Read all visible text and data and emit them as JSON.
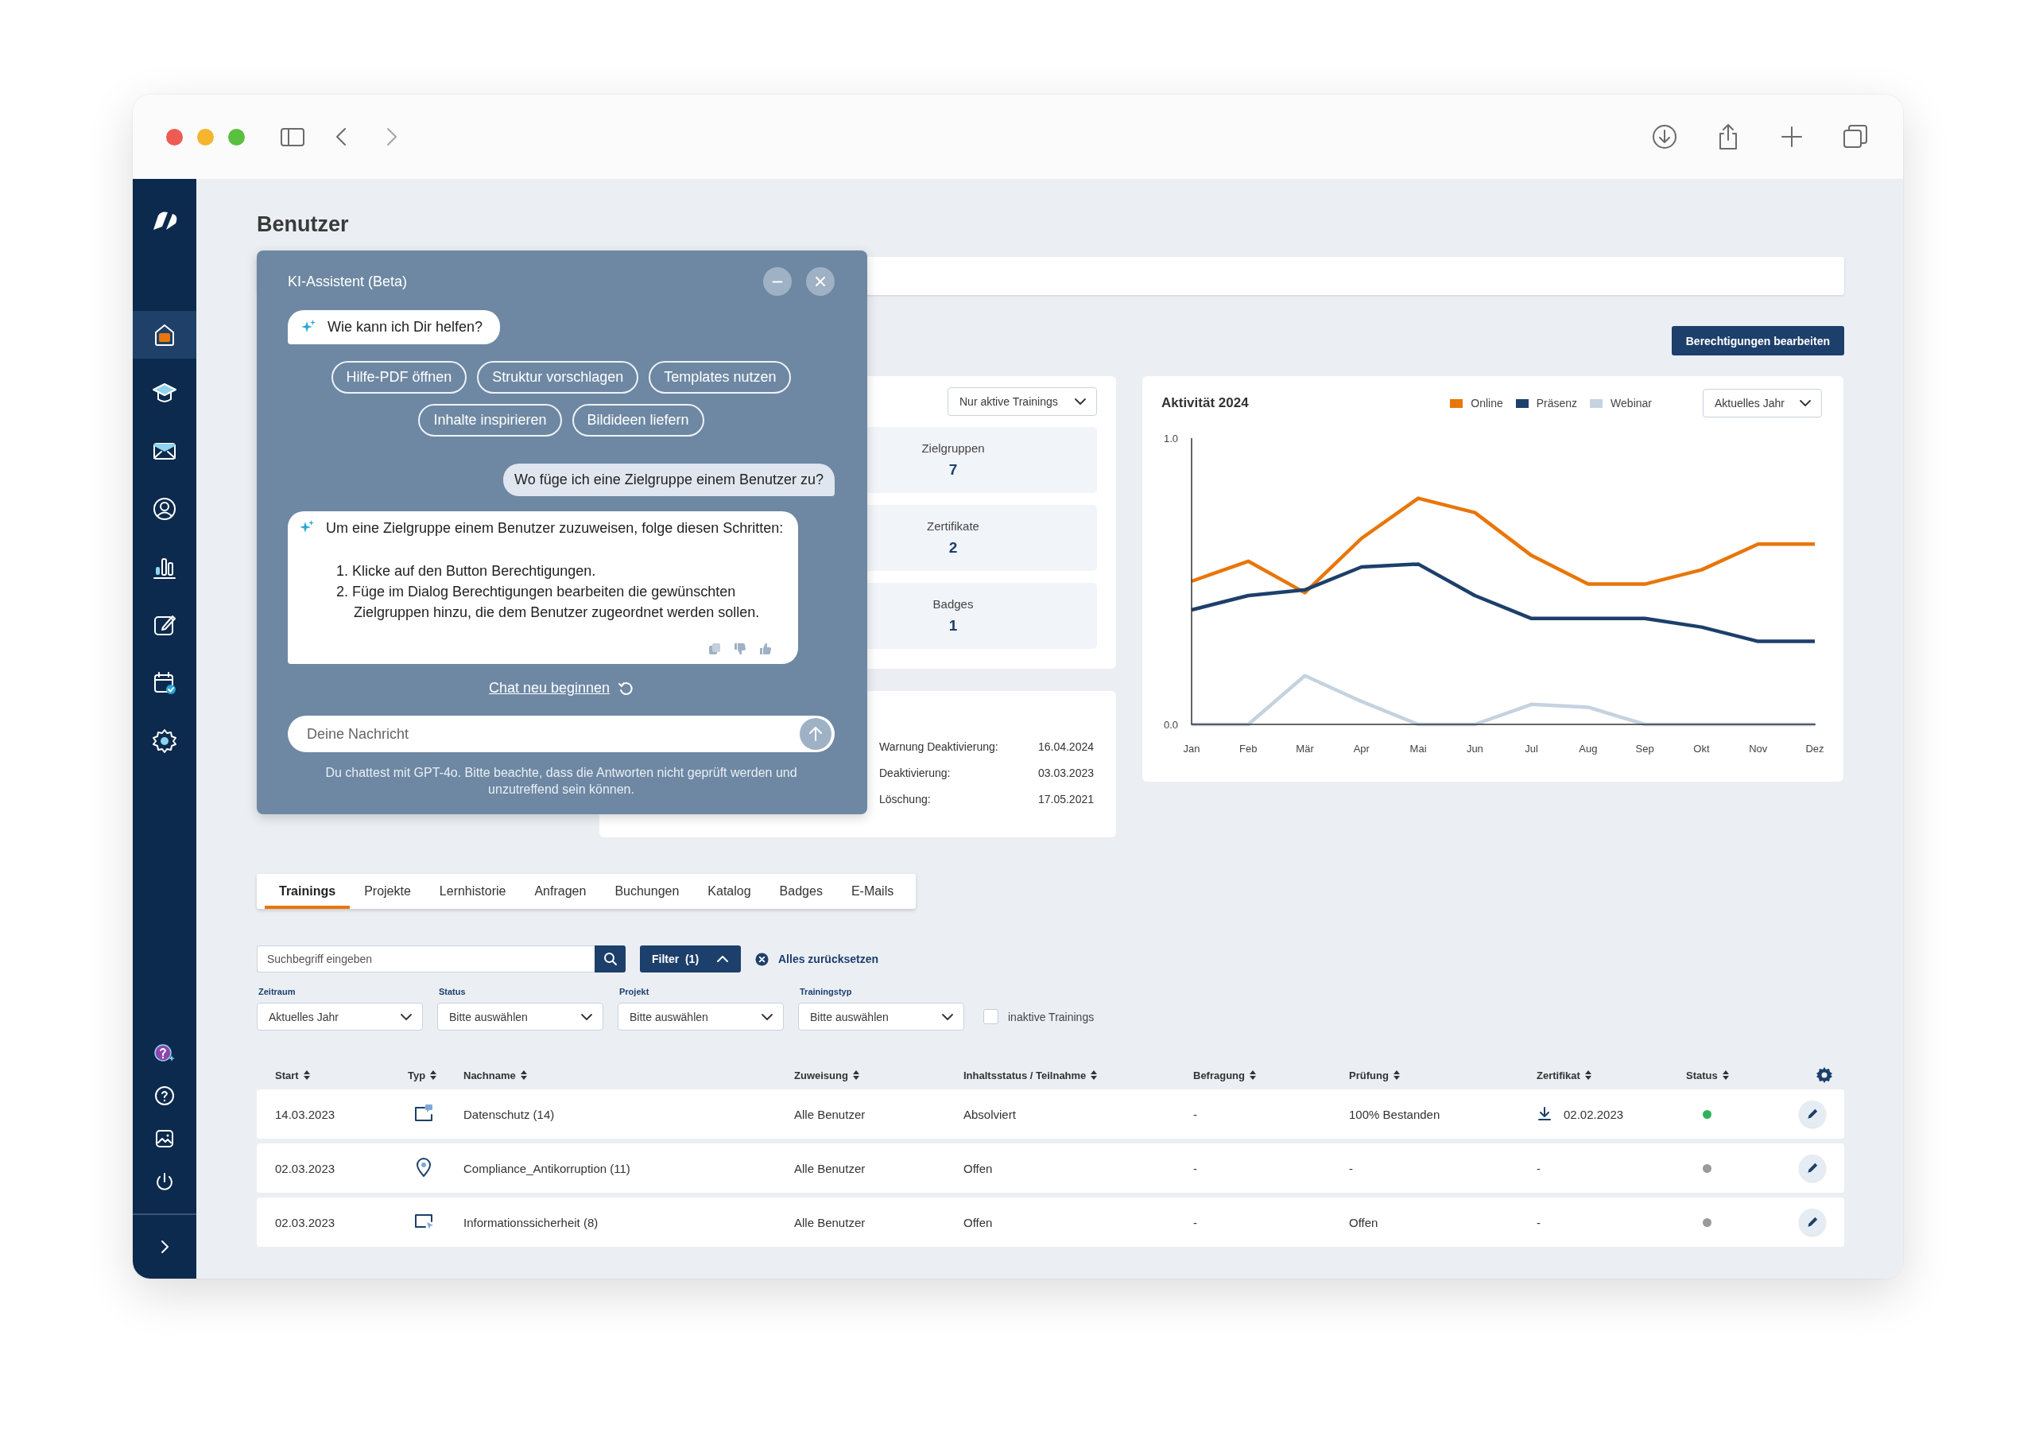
{
  "sidebar": {
    "items": [
      {
        "selected": true
      },
      {
        "selected": false
      },
      {
        "selected": false
      },
      {
        "selected": false
      },
      {
        "selected": false
      },
      {
        "selected": false
      },
      {
        "selected": false
      },
      {
        "selected": false
      }
    ]
  },
  "page": {
    "title": "Benutzer"
  },
  "actions": {
    "edit_permissions": "Berechtigungen bearbeiten"
  },
  "overview": {
    "filter": "Nur aktive Trainings",
    "stats": [
      {
        "label": "Zielgruppen",
        "value": "7"
      },
      {
        "label": "Zertifikate",
        "value": "2"
      },
      {
        "label": "Badges",
        "value": "1"
      }
    ]
  },
  "account": {
    "rows": [
      {
        "label": "Warnung Deaktivierung:",
        "value": "16.04.2024"
      },
      {
        "label": "Deaktivierung:",
        "value": "03.03.2023"
      },
      {
        "label": "Löschung:",
        "value": "17.05.2021"
      }
    ]
  },
  "activity": {
    "title": "Aktivität 2024",
    "period": "Aktuelles Jahr",
    "chart_data": {
      "type": "line",
      "categories": [
        "Jan",
        "Feb",
        "Mär",
        "Apr",
        "Mai",
        "Jun",
        "Jul",
        "Aug",
        "Sep",
        "Okt",
        "Nov",
        "Dez"
      ],
      "ylim": [
        0,
        1
      ],
      "yticks": [
        {
          "value": 0,
          "label": "0.0"
        },
        {
          "value": 1,
          "label": "1.0"
        }
      ],
      "series": [
        {
          "name": "Online",
          "color": "#e8760a",
          "values": [
            0.5,
            0.57,
            0.46,
            0.65,
            0.79,
            0.74,
            0.59,
            0.49,
            0.49,
            0.54,
            0.63,
            0.63
          ]
        },
        {
          "name": "Präsenz",
          "color": "#1d3f6b",
          "values": [
            0.4,
            0.45,
            0.47,
            0.55,
            0.56,
            0.45,
            0.37,
            0.37,
            0.37,
            0.34,
            0.29,
            0.29
          ]
        },
        {
          "name": "Webinar",
          "color": "#c5d2e0",
          "values": [
            0,
            0,
            0.17,
            0.08,
            0,
            0,
            0.07,
            0.06,
            0,
            0,
            0,
            0
          ]
        }
      ]
    }
  },
  "tabs": [
    {
      "label": "Trainings",
      "selected": true
    },
    {
      "label": "Projekte",
      "selected": false
    },
    {
      "label": "Lernhistorie",
      "selected": false
    },
    {
      "label": "Anfragen",
      "selected": false
    },
    {
      "label": "Buchungen",
      "selected": false
    },
    {
      "label": "Katalog",
      "selected": false
    },
    {
      "label": "Badges",
      "selected": false
    },
    {
      "label": "E-Mails",
      "selected": false
    }
  ],
  "search": {
    "placeholder": "Suchbegriff eingeben"
  },
  "filter_button": {
    "label": "Filter  (1)",
    "expanded": true
  },
  "reset": "Alles zurücksetzen",
  "filters": [
    {
      "label": "Zeitraum",
      "value": "Aktuelles Jahr"
    },
    {
      "label": "Status",
      "value": "Bitte auswählen"
    },
    {
      "label": "Projekt",
      "value": "Bitte auswählen"
    },
    {
      "label": "Trainingstyp",
      "value": "Bitte auswählen"
    }
  ],
  "inactive_toggle": {
    "label": "inaktive Trainings",
    "checked": false
  },
  "table": {
    "columns": [
      "Start",
      "Typ",
      "Nachname",
      "Zuweisung",
      "Inhaltsstatus / Teilnahme",
      "Befragung",
      "Prüfung",
      "Zertifikat",
      "Status"
    ],
    "rows": [
      {
        "start": "14.03.2023",
        "kind": "chat",
        "name": "Datenschutz (14)",
        "assignment": "Alle Benutzer",
        "content_status": "Absolviert",
        "survey": "-",
        "exam": "100% Bestanden",
        "certificate": {
          "value": "02.02.2023",
          "download": true
        },
        "color": "#2fb25a"
      },
      {
        "start": "02.03.2023",
        "kind": "location",
        "name": "Compliance_Antikorruption (11)",
        "assignment": "Alle Benutzer",
        "content_status": "Offen",
        "survey": "-",
        "exam": "-",
        "certificate": {
          "value": "-",
          "download": false
        },
        "color": "#9a9a9a"
      },
      {
        "start": "02.03.2023",
        "kind": "screen",
        "name": "Informationssicherheit (8)",
        "assignment": "Alle Benutzer",
        "content_status": "Offen",
        "survey": "-",
        "exam": "Offen",
        "certificate": {
          "value": "-",
          "download": false
        },
        "color": "#9a9a9a"
      }
    ]
  },
  "chat": {
    "title": "KI-Assistent (Beta)",
    "greeting": "Wie kann ich Dir helfen?",
    "suggestions": [
      [
        "Hilfe-PDF öffnen",
        "Struktur vorschlagen",
        "Templates nutzen"
      ],
      [
        "Inhalte inspirieren",
        "Bildideen liefern"
      ]
    ],
    "messages": [
      {
        "kind": "user",
        "text": "Wo füge ich eine Zielgruppe einem Benutzer zu?"
      },
      {
        "kind": "assistant",
        "intro": "Um eine Zielgruppe einem Benutzer zuzuweisen, folge diesen Schritten:",
        "steps": [
          {
            "number": "1.",
            "text": "Klicke auf den Button Berechtigungen."
          },
          {
            "number": "2.",
            "text": "Füge im Dialog Berechtigungen bearbeiten die gewünschten Zielgruppen hinzu, die dem Benutzer zugeordnet werden sollen."
          }
        ]
      }
    ],
    "restart": "Chat neu beginnen",
    "input": {
      "placeholder": "Deine Nachricht"
    },
    "disclaimer": "Du chattest mit GPT-4o. Bitte beachte, dass die Antworten nicht geprüft werden und unzutreffend sein können."
  }
}
